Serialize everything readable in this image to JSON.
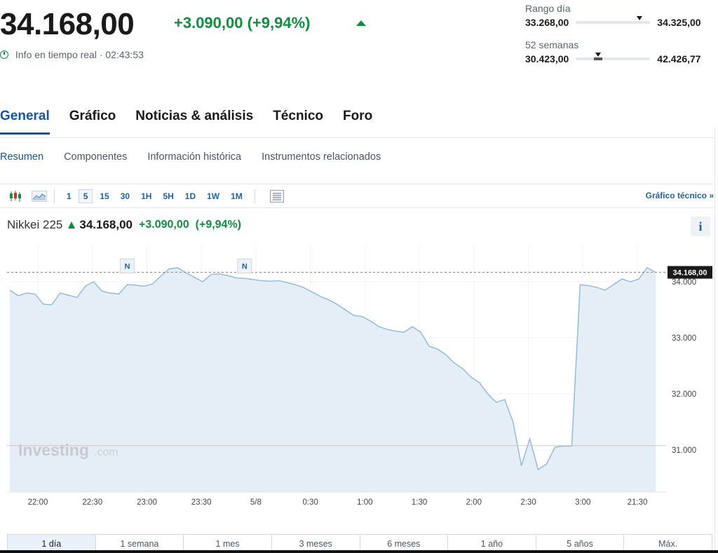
{
  "header": {
    "price": "34.168,00",
    "change": "+3.090,00 (+9,94%)",
    "realtime": "Info en tiempo real · 02:43:53"
  },
  "ranges": {
    "day": {
      "label": "Rango día",
      "low": "33.268,00",
      "high": "34.325,00",
      "position": 0.86
    },
    "weeks52": {
      "label": "52 semanas",
      "low": "30.423,00",
      "high": "42.426,77",
      "position": 0.3
    }
  },
  "main_tabs": [
    "General",
    "Gráfico",
    "Noticias & análisis",
    "Técnico",
    "Foro"
  ],
  "sub_tabs": [
    "Resumen",
    "Componentes",
    "Información histórica",
    "Instrumentos relacionados"
  ],
  "toolbar": {
    "intervals": [
      "1",
      "5",
      "15",
      "30",
      "1H",
      "5H",
      "1D",
      "1W",
      "1M"
    ],
    "active_interval": "5",
    "tech_link": "Gráfico técnico »",
    "icons": [
      "candlestick-icon",
      "area-chart-icon",
      "table-icon"
    ]
  },
  "quote": {
    "name": "Nikkei 225",
    "price": "34.168,00",
    "change": "+3.090,00",
    "pct": "(+9,94%)",
    "info": "i"
  },
  "chart_data": {
    "type": "area",
    "watermark_main": "Investing",
    "watermark_sub": ".com",
    "last_label": "34.168,00",
    "last_value": 34168,
    "reference_value": 31078,
    "yticks": [
      {
        "v": 34000,
        "t": "34.000"
      },
      {
        "v": 33000,
        "t": "33.000"
      },
      {
        "v": 32000,
        "t": "32.000"
      },
      {
        "v": 31000,
        "t": "31.000"
      }
    ],
    "xticks": [
      "22:00",
      "22:30",
      "23:00",
      "23:30",
      "5/8",
      "0:30",
      "1:00",
      "1:30",
      "2:00",
      "2:30",
      "3:00",
      "21:30"
    ],
    "ylim": [
      30250,
      34550
    ],
    "news_markers": [
      "N",
      "N"
    ],
    "values": [
      33850,
      33750,
      33800,
      33780,
      33600,
      33590,
      33800,
      33760,
      33720,
      33920,
      34000,
      33830,
      33800,
      33780,
      33950,
      33940,
      33920,
      33960,
      34100,
      34230,
      34250,
      34160,
      34080,
      34000,
      34130,
      34140,
      34110,
      34070,
      34060,
      34040,
      34020,
      34010,
      34020,
      33990,
      33950,
      33900,
      33820,
      33740,
      33680,
      33600,
      33500,
      33400,
      33380,
      33300,
      33200,
      33150,
      33120,
      33100,
      33200,
      33100,
      32850,
      32800,
      32700,
      32550,
      32450,
      32300,
      32200,
      32000,
      31850,
      31900,
      31500,
      30720,
      31200,
      30650,
      30750,
      31050,
      31070,
      31070,
      33950,
      33930,
      33900,
      33850,
      33950,
      34050,
      34000,
      34050,
      34250,
      34168
    ]
  },
  "periods": [
    "1 día",
    "1 semana",
    "1 mes",
    "3 meses",
    "6 meses",
    "1 año",
    "5 años",
    "Máx."
  ],
  "active_period": "1 día"
}
